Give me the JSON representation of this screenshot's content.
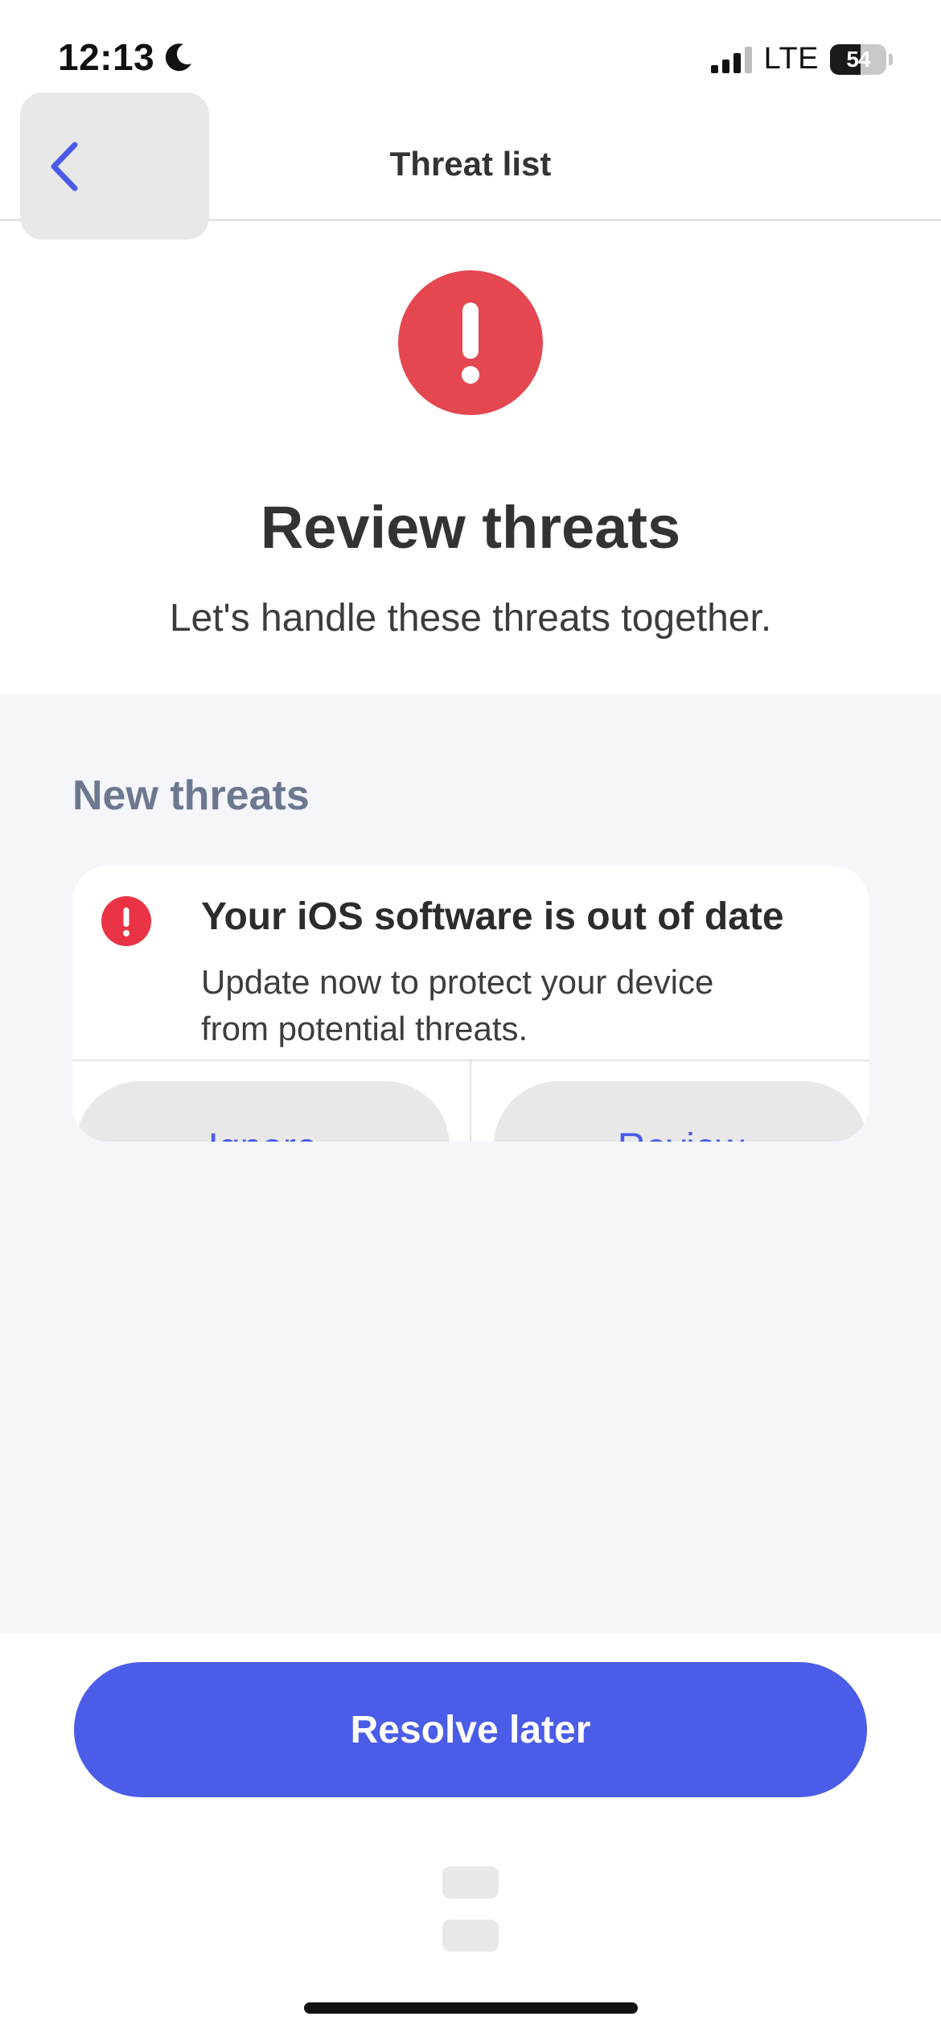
{
  "status_bar": {
    "time": "12:13",
    "network": "LTE",
    "battery_level": "54",
    "battery_fraction": 0.54
  },
  "nav": {
    "title": "Threat list",
    "back_icon": "chevron-left-icon"
  },
  "hero": {
    "icon": "alert-exclamation-icon",
    "title": "Review threats",
    "subtitle": "Let's handle these threats together."
  },
  "threats": {
    "heading": "New threats",
    "items": [
      {
        "icon": "alert-exclamation-icon",
        "title": "Your iOS software is out of date",
        "description": "Update now to protect your device from potential threats.",
        "ignore_label": "Ignore",
        "review_label": "Review"
      }
    ]
  },
  "footer": {
    "resolve_label": "Resolve later"
  },
  "colors": {
    "accent": "#4a5ce8",
    "alert": "#e54750",
    "heading_muted": "#6d7790",
    "content_bg": "#f4f6fa"
  }
}
